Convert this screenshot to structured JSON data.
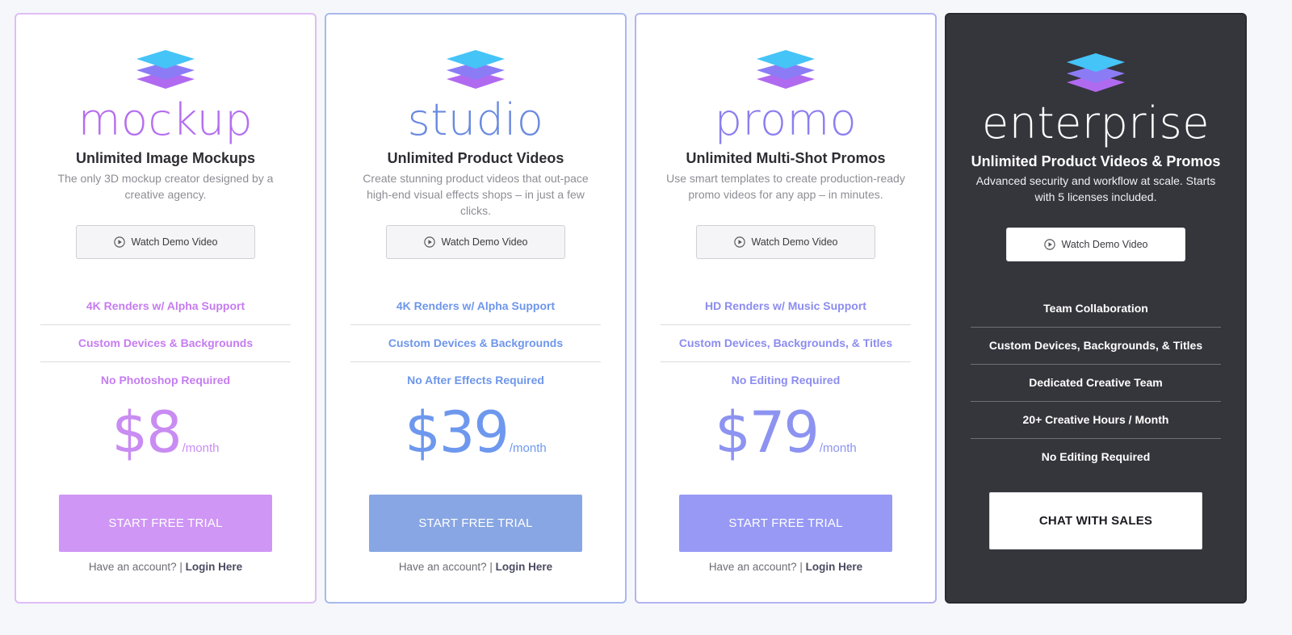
{
  "colors": {
    "mockup": "#c98cf2",
    "studio": "#6e98ee",
    "promo": "#8d93f0",
    "enterprise_bg": "#35353c"
  },
  "plans": [
    {
      "name": "mockup",
      "headline": "Unlimited Image Mockups",
      "description": "The only 3D mockup creator designed by a creative agency.",
      "demo_label": "Watch Demo Video",
      "features": [
        "4K Renders w/ Alpha Support",
        "Custom Devices & Backgrounds",
        "No Photoshop Required"
      ],
      "price": "$8",
      "period": "/month",
      "cta": "START FREE TRIAL",
      "account_text": "Have an account? | ",
      "login_label": "Login Here"
    },
    {
      "name": "studio",
      "headline": "Unlimited Product Videos",
      "description": "Create stunning product videos that out-pace high-end visual effects shops – in just a few clicks.",
      "demo_label": "Watch Demo Video",
      "features": [
        "4K Renders w/ Alpha Support",
        "Custom Devices & Backgrounds",
        "No After Effects Required"
      ],
      "price": "$39",
      "period": "/month",
      "cta": "START FREE TRIAL",
      "account_text": "Have an account? | ",
      "login_label": "Login Here"
    },
    {
      "name": "promo",
      "headline": "Unlimited Multi-Shot Promos",
      "description": "Use smart templates to create production-ready promo videos for any app – in minutes.",
      "demo_label": "Watch Demo Video",
      "features": [
        "HD Renders w/ Music Support",
        "Custom Devices, Backgrounds, & Titles",
        "No Editing Required"
      ],
      "price": "$79",
      "period": "/month",
      "cta": "START FREE TRIAL",
      "account_text": "Have an account? | ",
      "login_label": "Login Here"
    },
    {
      "name": "enterprise",
      "headline": "Unlimited Product Videos & Promos",
      "description": "Advanced security and workflow at scale. Starts with 5 licenses included.",
      "demo_label": "Watch Demo Video",
      "features": [
        "Team Collaboration",
        "Custom Devices, Backgrounds, & Titles",
        "Dedicated Creative Team",
        "20+ Creative Hours / Month",
        "No Editing Required"
      ],
      "cta": "CHAT WITH SALES"
    }
  ],
  "icons": {
    "logo": "layers-stack-icon",
    "demo": "play-circle-icon"
  }
}
